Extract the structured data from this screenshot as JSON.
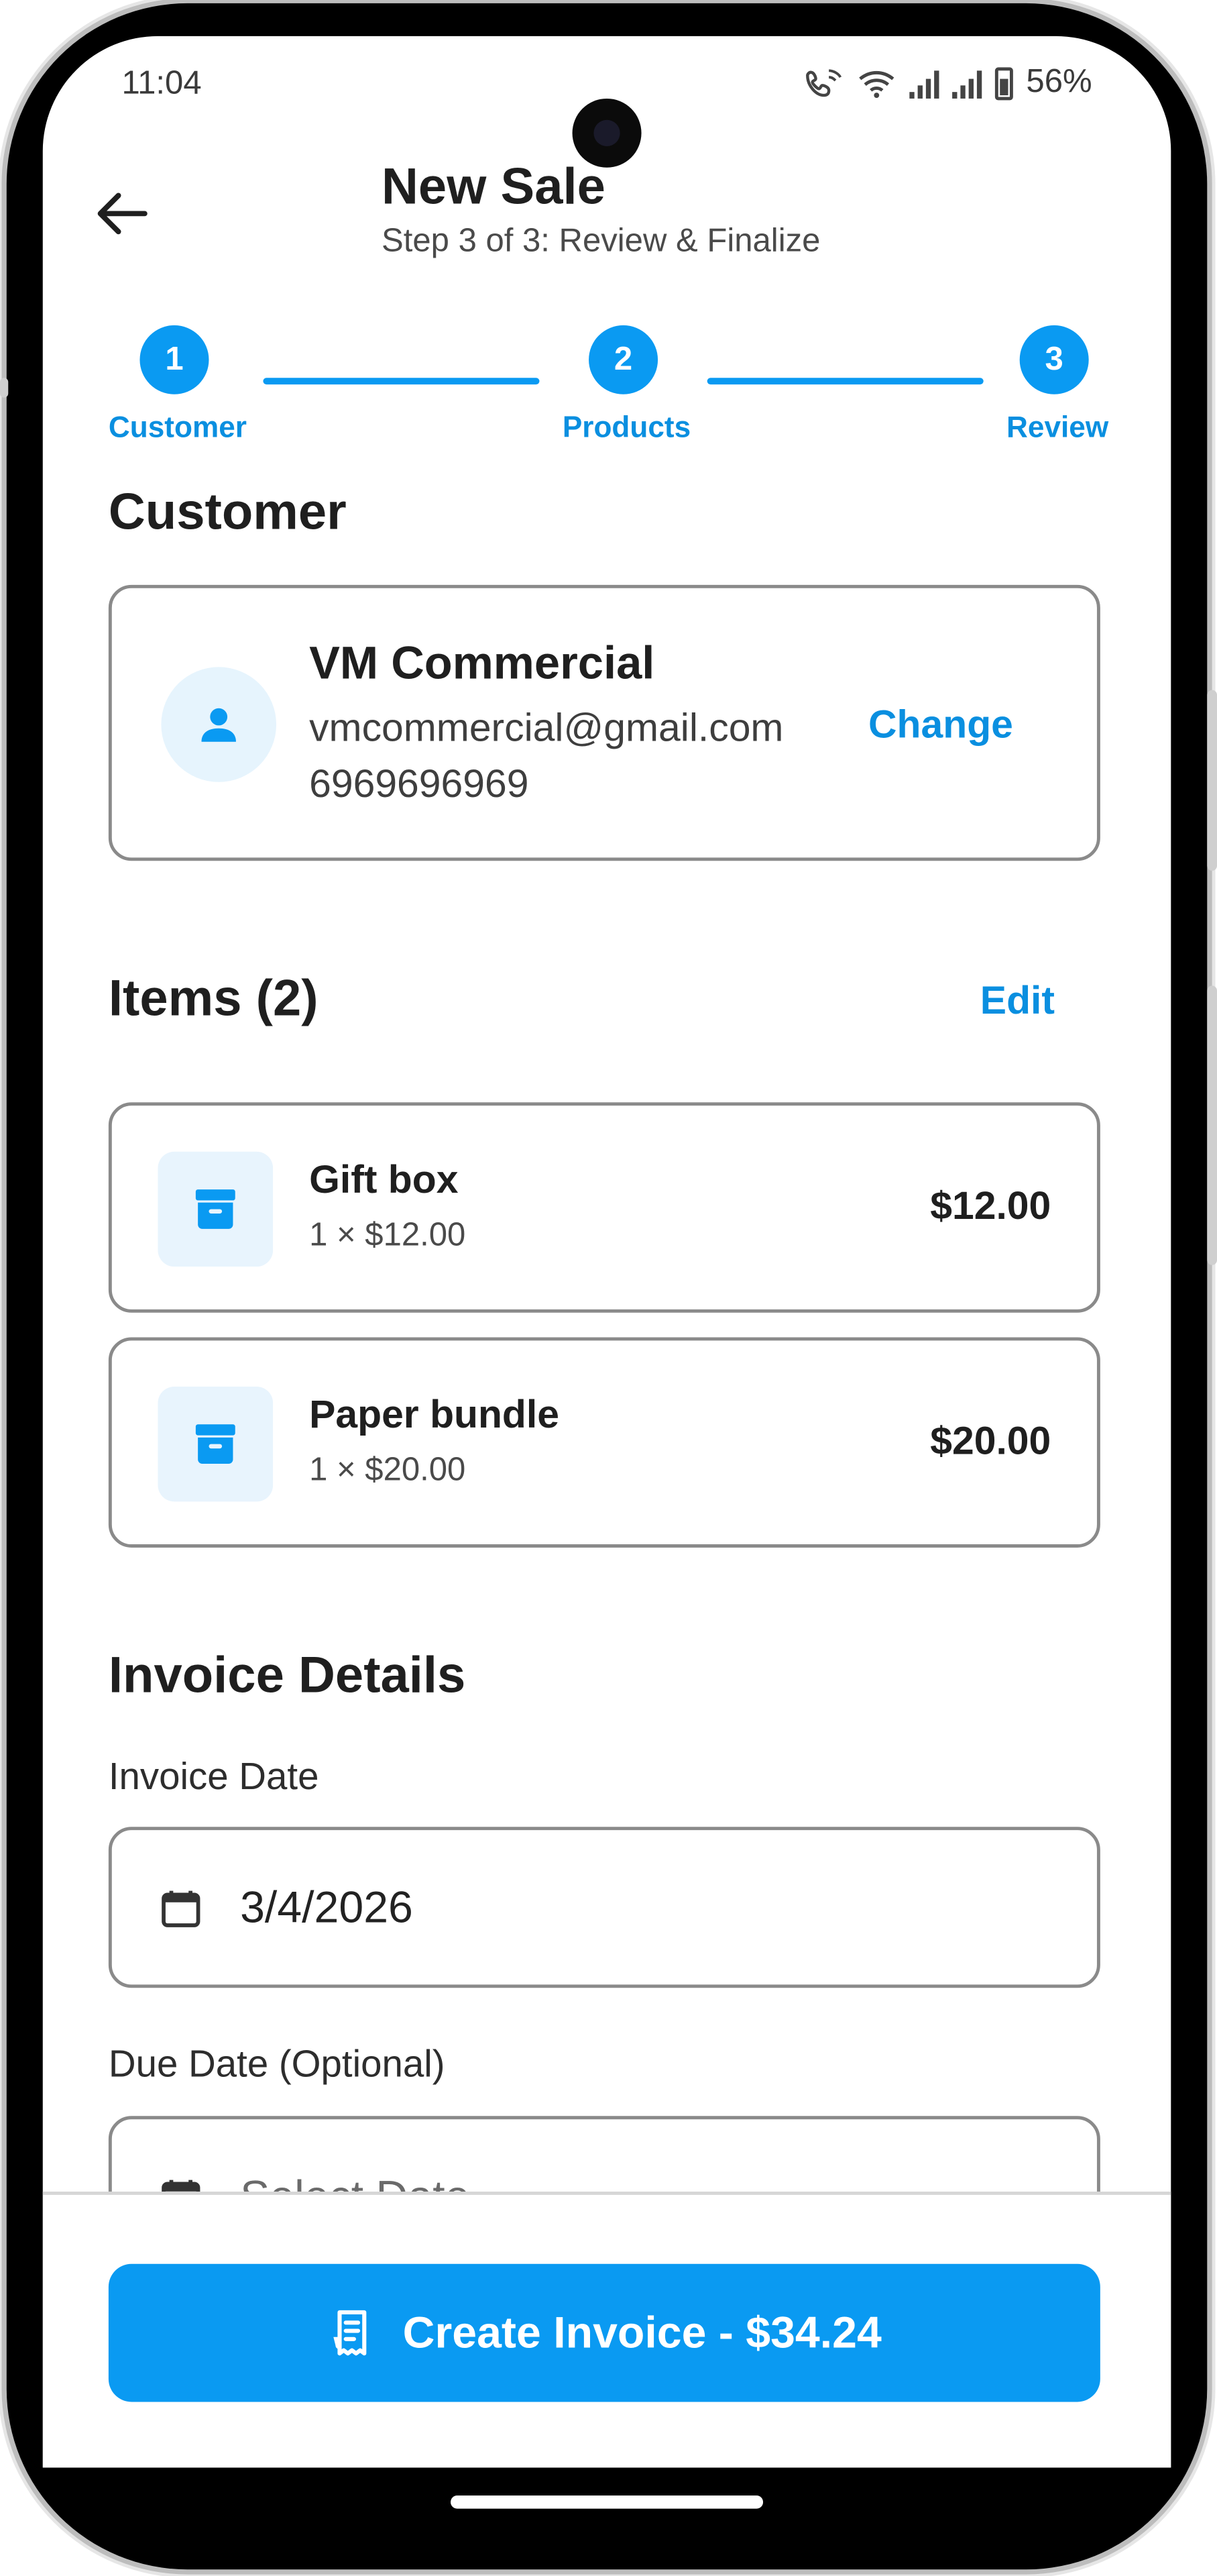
{
  "status_bar": {
    "time": "11:04",
    "battery": "56%"
  },
  "header": {
    "title": "New Sale",
    "subtitle": "Step 3 of 3: Review & Finalize"
  },
  "stepper": {
    "steps": [
      {
        "number": "1",
        "label": "Customer"
      },
      {
        "number": "2",
        "label": "Products"
      },
      {
        "number": "3",
        "label": "Review"
      }
    ]
  },
  "customer": {
    "section_title": "Customer",
    "name": "VM Commercial",
    "email": "vmcommercial@gmail.com",
    "phone": "6969696969",
    "change_label": "Change"
  },
  "items": {
    "section_title": "Items (2)",
    "edit_label": "Edit",
    "list": [
      {
        "name": "Gift box",
        "qty_price": "1 × $12.00",
        "total": "$12.00"
      },
      {
        "name": "Paper bundle",
        "qty_price": "1 × $20.00",
        "total": "$20.00"
      }
    ]
  },
  "invoice_details": {
    "section_title": "Invoice Details",
    "invoice_date_label": "Invoice Date",
    "invoice_date_value": "3/4/2026",
    "due_date_label": "Due Date (Optional)",
    "due_date_placeholder": "Select Date"
  },
  "footer": {
    "create_button_label": "Create Invoice - $34.24"
  },
  "colors": {
    "accent": "#0a9af2",
    "accent_text": "#0a8fe0",
    "icon_bg": "#e8f4fd"
  }
}
